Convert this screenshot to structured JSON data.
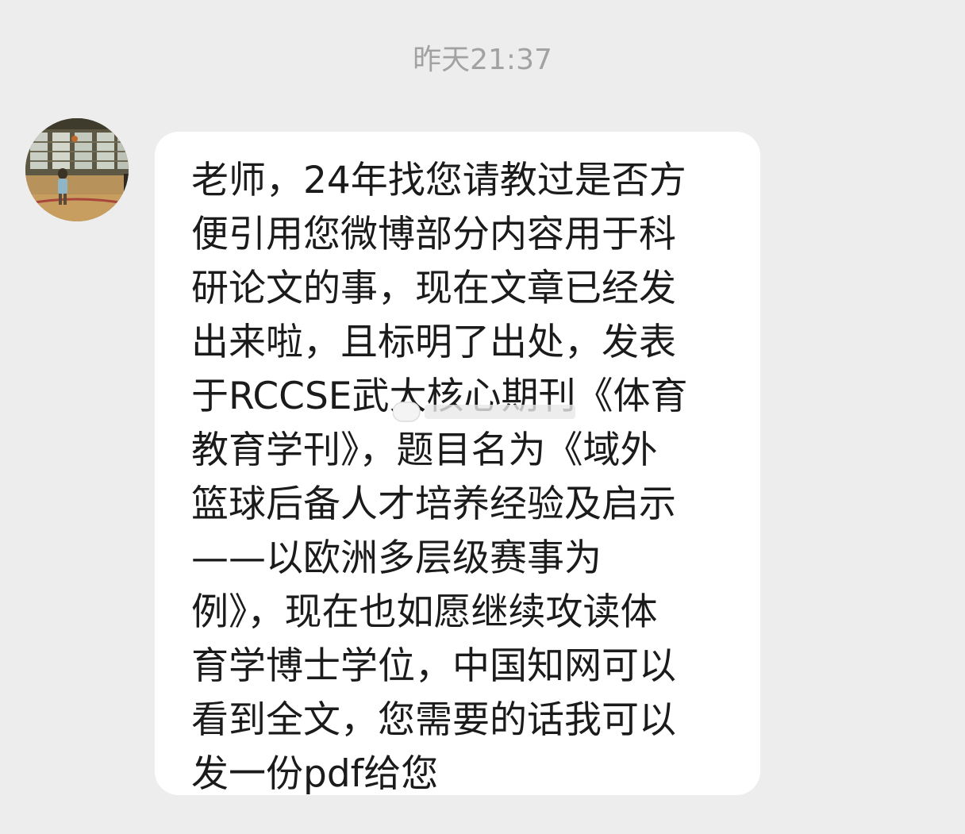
{
  "chat": {
    "timestamp": "昨天21:37",
    "message": {
      "lines": [
        "老师，24年找您请教过是否方",
        "便引用您微博部分内容用于科",
        "研论文的事，现在文章已经发",
        "出来啦，且标明了出处，发表",
        "于RCCSE武大核心期刊《体育",
        "教育学刊》，题目名为《域外",
        "篮球后备人才培养经验及启示",
        "——以欧洲多层级赛事为",
        "例》，现在也如愿继续攻读体",
        "育学博士学位，中国知网可以",
        "看到全文，您需要的话我可以",
        "发一份pdf给您"
      ]
    }
  },
  "colors": {
    "background": "#ededed",
    "bubble": "#ffffff",
    "text": "#1b1b1b",
    "timestamp": "#a2a2a2"
  },
  "icons": {
    "avatar": "avatar-photo-basketball-court"
  }
}
